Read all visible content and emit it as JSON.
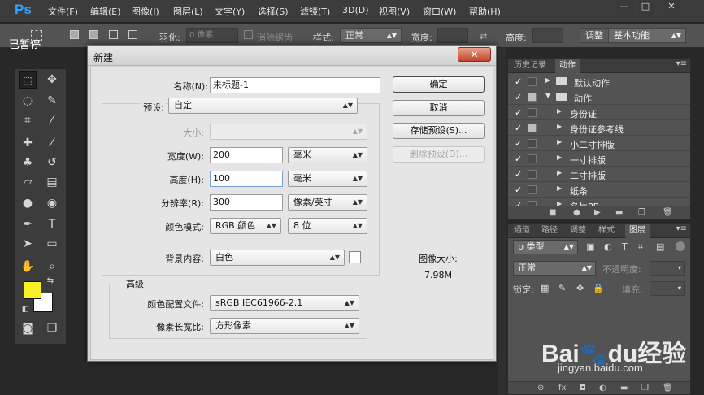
{
  "app": {
    "logo": "Ps"
  },
  "status_overlay": "已暂停",
  "menu": [
    "文件(F)",
    "编辑(E)",
    "图像(I)",
    "图层(L)",
    "文字(Y)",
    "选择(S)",
    "滤镜(T)",
    "3D(D)",
    "视图(V)",
    "窗口(W)",
    "帮助(H)"
  ],
  "window_controls": {
    "minimize": "—",
    "restore": "□",
    "close": "✕"
  },
  "options_bar": {
    "feather_label": "羽化:",
    "feather_value": "0 像素",
    "antialias_label": "消除锯齿",
    "style_label": "样式:",
    "style_value": "正常",
    "width_label": "宽度:",
    "height_label": "高度:",
    "refine_label": "调整",
    "workspace_value": "基本功能"
  },
  "colors": {
    "foreground": "#f6f225",
    "background": "#ffffff"
  },
  "dialog": {
    "title": "新建",
    "close_glyph": "✕",
    "name_label": "名称(N):",
    "name_value": "未标题-1",
    "preset_label": "预设:",
    "preset_value": "自定",
    "size_label": "大小:",
    "size_value": "",
    "width_label": "宽度(W):",
    "width_value": "200",
    "width_unit": "毫米",
    "height_label": "高度(H):",
    "height_value": "100",
    "height_unit": "毫米",
    "resolution_label": "分辨率(R):",
    "resolution_value": "300",
    "resolution_unit": "像素/英寸",
    "color_mode_label": "颜色模式:",
    "color_mode_value": "RGB 颜色",
    "bit_depth_value": "8 位",
    "bg_contents_label": "背景内容:",
    "bg_contents_value": "白色",
    "advanced_label": "高级",
    "color_profile_label": "颜色配置文件:",
    "color_profile_value": "sRGB IEC61966-2.1",
    "pixel_aspect_label": "像素长宽比:",
    "pixel_aspect_value": "方形像素",
    "ok_button": "确定",
    "cancel_button": "取消",
    "save_preset_button": "存储预设(S)...",
    "delete_preset_button": "删除预设(D)...",
    "image_size_label": "图像大小:",
    "image_size_value": "7.98M"
  },
  "actions_panel": {
    "tabs": [
      "历史记录",
      "动作"
    ],
    "active_tab": 1,
    "items": [
      {
        "name": "默认动作",
        "level": 0,
        "folder": true,
        "expanded": false,
        "dialog_fill": false
      },
      {
        "name": "动作",
        "level": 0,
        "folder": true,
        "expanded": true,
        "dialog_fill": true
      },
      {
        "name": "身份证",
        "level": 1,
        "folder": false,
        "expanded": false,
        "dialog_fill": false
      },
      {
        "name": "身份证参考线",
        "level": 1,
        "folder": false,
        "expanded": false,
        "dialog_fill": true
      },
      {
        "name": "小二寸排版",
        "level": 1,
        "folder": false,
        "expanded": false,
        "dialog_fill": false
      },
      {
        "name": "一寸排版",
        "level": 1,
        "folder": false,
        "expanded": false,
        "dialog_fill": false
      },
      {
        "name": "二寸排版",
        "level": 1,
        "folder": false,
        "expanded": false,
        "dialog_fill": false
      },
      {
        "name": "纸条",
        "level": 1,
        "folder": false,
        "expanded": false,
        "dialog_fill": false
      },
      {
        "name": "名片PB",
        "level": 1,
        "folder": false,
        "expanded": false,
        "dialog_fill": false
      }
    ]
  },
  "layers_panel": {
    "tabs": [
      "通道",
      "路径",
      "调整",
      "样式",
      "图层"
    ],
    "active_tab": 4,
    "filter_value": "ρ 类型",
    "blend_mode": "正常",
    "opacity_label": "不透明度:",
    "lock_label": "锁定:",
    "fill_label": "填充:"
  },
  "watermark": {
    "brand": "Bai",
    "brand2": "du",
    "cn": "经验",
    "url": "jingyan.baidu.com"
  }
}
